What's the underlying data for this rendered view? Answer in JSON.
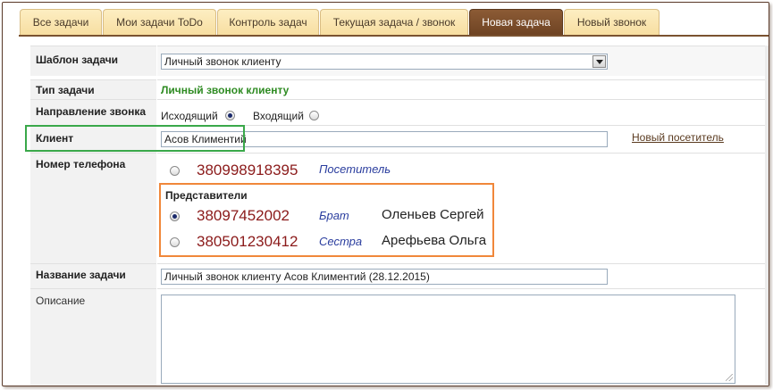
{
  "tabs": [
    {
      "label": "Все задачи"
    },
    {
      "label": "Мои задачи ToDo"
    },
    {
      "label": "Контроль задач"
    },
    {
      "label": "Текущая задача / звонок"
    },
    {
      "label": "Новая задача"
    },
    {
      "label": "Новый звонок"
    }
  ],
  "active_tab": "Новая задача",
  "form": {
    "template": {
      "label": "Шаблон задачи",
      "value": "Личный звонок клиенту"
    },
    "task_type": {
      "label": "Тип задачи",
      "value": "Личный звонок клиенту"
    },
    "direction": {
      "label": "Направление звонка",
      "outgoing": "Исходящий",
      "incoming": "Входящий",
      "selected": "Исходящий"
    },
    "client": {
      "label": "Клиент",
      "value": "Асов Климентий",
      "new_link": "Новый посетитель"
    },
    "phone": {
      "label": "Номер телефона",
      "own": {
        "number": "380998918395",
        "relation": "Посетитель"
      },
      "reps_title": "Представители",
      "reps": [
        {
          "number": "38097452002",
          "relation": "Брат",
          "name": "Оленьев Сергей",
          "selected": true
        },
        {
          "number": "380501230412",
          "relation": "Сестра",
          "name": "Арефьева Ольга",
          "selected": false
        }
      ]
    },
    "task_name": {
      "label": "Название задачи",
      "value": "Личный звонок клиенту Асов Климентий (28.12.2015)"
    },
    "description": {
      "label": "Описание",
      "value": ""
    }
  },
  "colors": {
    "accent": "#7a5230",
    "tab": "#f7dea1",
    "highlight_client": "#3aa84a",
    "highlight_reps": "#f0873a",
    "phone": "#8b1a1a",
    "relation": "#2a3d9e",
    "task_type": "#2e8b22"
  }
}
